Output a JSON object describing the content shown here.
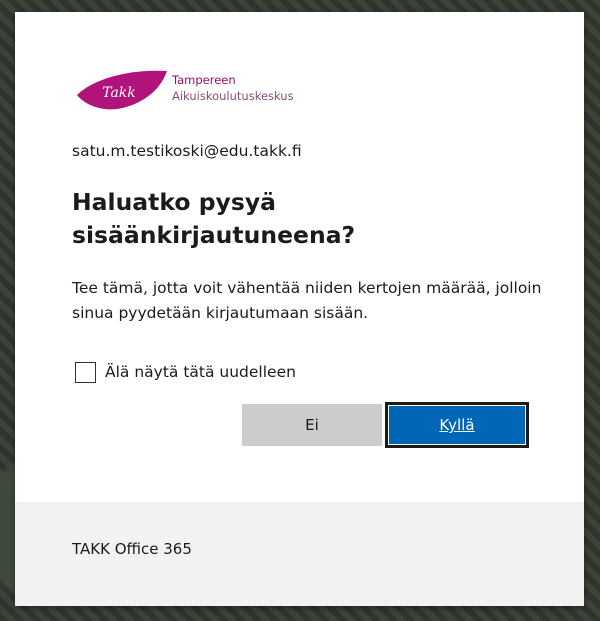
{
  "logo": {
    "mark_text": "Takk",
    "line1": "Tampereen",
    "line2": "Aikuiskoulutuskeskus",
    "brand_color": "#a10a6a"
  },
  "account": {
    "email": "satu.m.testikoski@edu.takk.fi"
  },
  "dialog": {
    "title": "Haluatko pysyä sisäänkirjautuneena?",
    "description": "Tee tämä, jotta voit vähentää niiden kertojen määrää, jolloin sinua pyydetään kirjautumaan sisään.",
    "checkbox_label": "Älä näytä tätä uudelleen",
    "checkbox_checked": false,
    "no_label": "Ei",
    "yes_label": "Kyllä",
    "primary_color": "#0067b8"
  },
  "footer": {
    "text": "TAKK Office 365"
  }
}
